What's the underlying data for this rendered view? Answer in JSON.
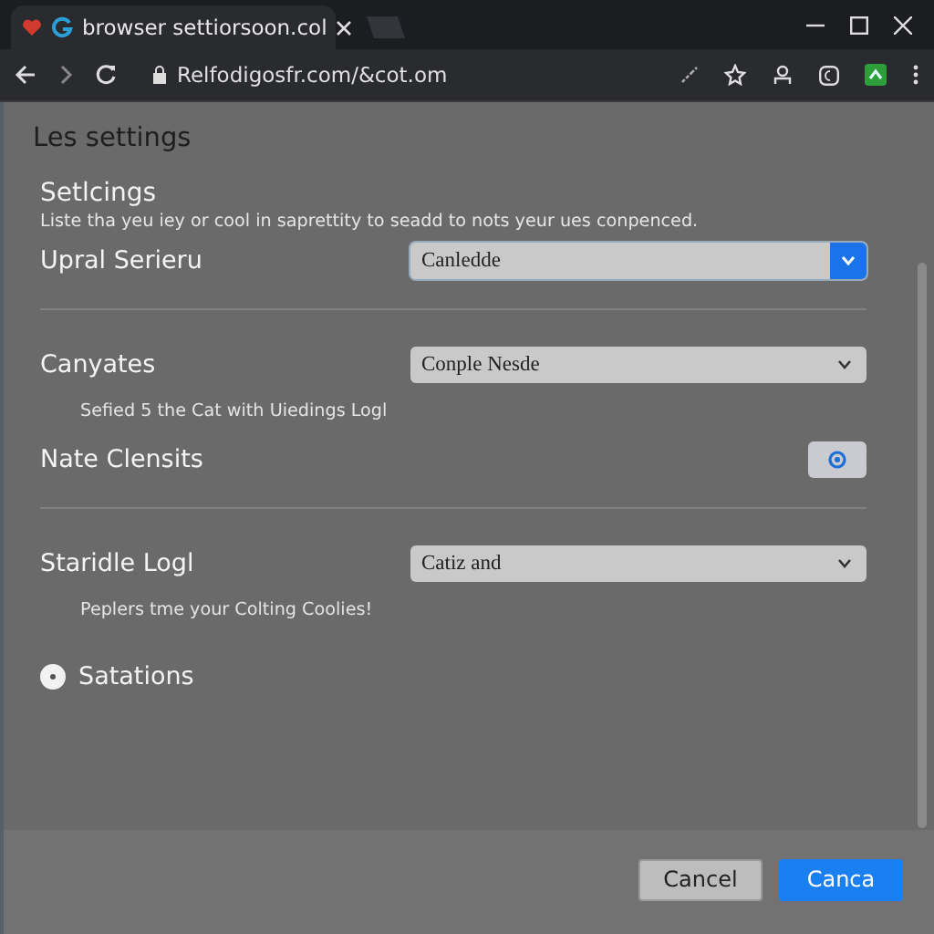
{
  "tab": {
    "title": "browser settiorsoon.col",
    "selected": true
  },
  "address_bar": {
    "url": "Relfodigosfr.com/&cot.om"
  },
  "page": {
    "heading": "Les settings",
    "section_title": "Setlcings",
    "description": "Liste tha yeu iey or cool in saprettity to seadd to nots yeur ues conpenced."
  },
  "settings": [
    {
      "kind": "select",
      "label": "Upral Serieru",
      "value": "Canledde",
      "focused": true,
      "divider_after": true
    },
    {
      "kind": "select",
      "label": "Canyates",
      "value": "Conple Nesde",
      "focused": false,
      "hint": "Sefied 5 the Cat with Uiedings Logl",
      "divider_after": false
    },
    {
      "kind": "button",
      "label": "Nate Clensits",
      "divider_after": true
    },
    {
      "kind": "select",
      "label": "Staridle Logl",
      "value": "Catiz and",
      "focused": false,
      "hint": "Peplers tme your Colting Coolies!",
      "divider_after": false
    },
    {
      "kind": "expander",
      "label": "Satations",
      "expanded": false
    }
  ],
  "buttons": [
    {
      "label": "Cancel",
      "kind": "secondary"
    },
    {
      "label": "Canca",
      "kind": "primary"
    }
  ]
}
